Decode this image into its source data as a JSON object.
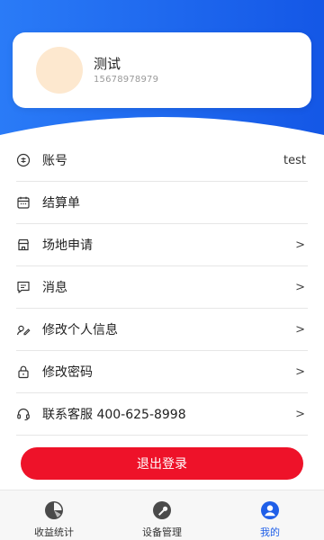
{
  "profile": {
    "name": "测试",
    "phone": "15678978979"
  },
  "menu": [
    {
      "label": "账号",
      "value": "test",
      "icon": "coin-icon"
    },
    {
      "label": "结算单",
      "icon": "calendar-icon"
    },
    {
      "label": "场地申请",
      "chevron": ">",
      "icon": "store-icon"
    },
    {
      "label": "消息",
      "chevron": ">",
      "icon": "message-icon"
    },
    {
      "label": "修改个人信息",
      "chevron": ">",
      "icon": "edit-profile-icon"
    },
    {
      "label": "修改密码",
      "chevron": ">",
      "icon": "lock-icon"
    },
    {
      "label": "联系客服 400-625-8998",
      "chevron": ">",
      "icon": "headset-icon"
    }
  ],
  "logout_label": "退出登录",
  "tabs": [
    {
      "label": "收益统计",
      "icon": "pie-chart-icon",
      "active": false
    },
    {
      "label": "设备管理",
      "icon": "wrench-icon",
      "active": false
    },
    {
      "label": "我的",
      "icon": "user-icon",
      "active": true
    }
  ],
  "colors": {
    "header_blue": "#1f6ff5",
    "logout_red": "#ee1229",
    "active_tab": "#1f5fe8"
  }
}
